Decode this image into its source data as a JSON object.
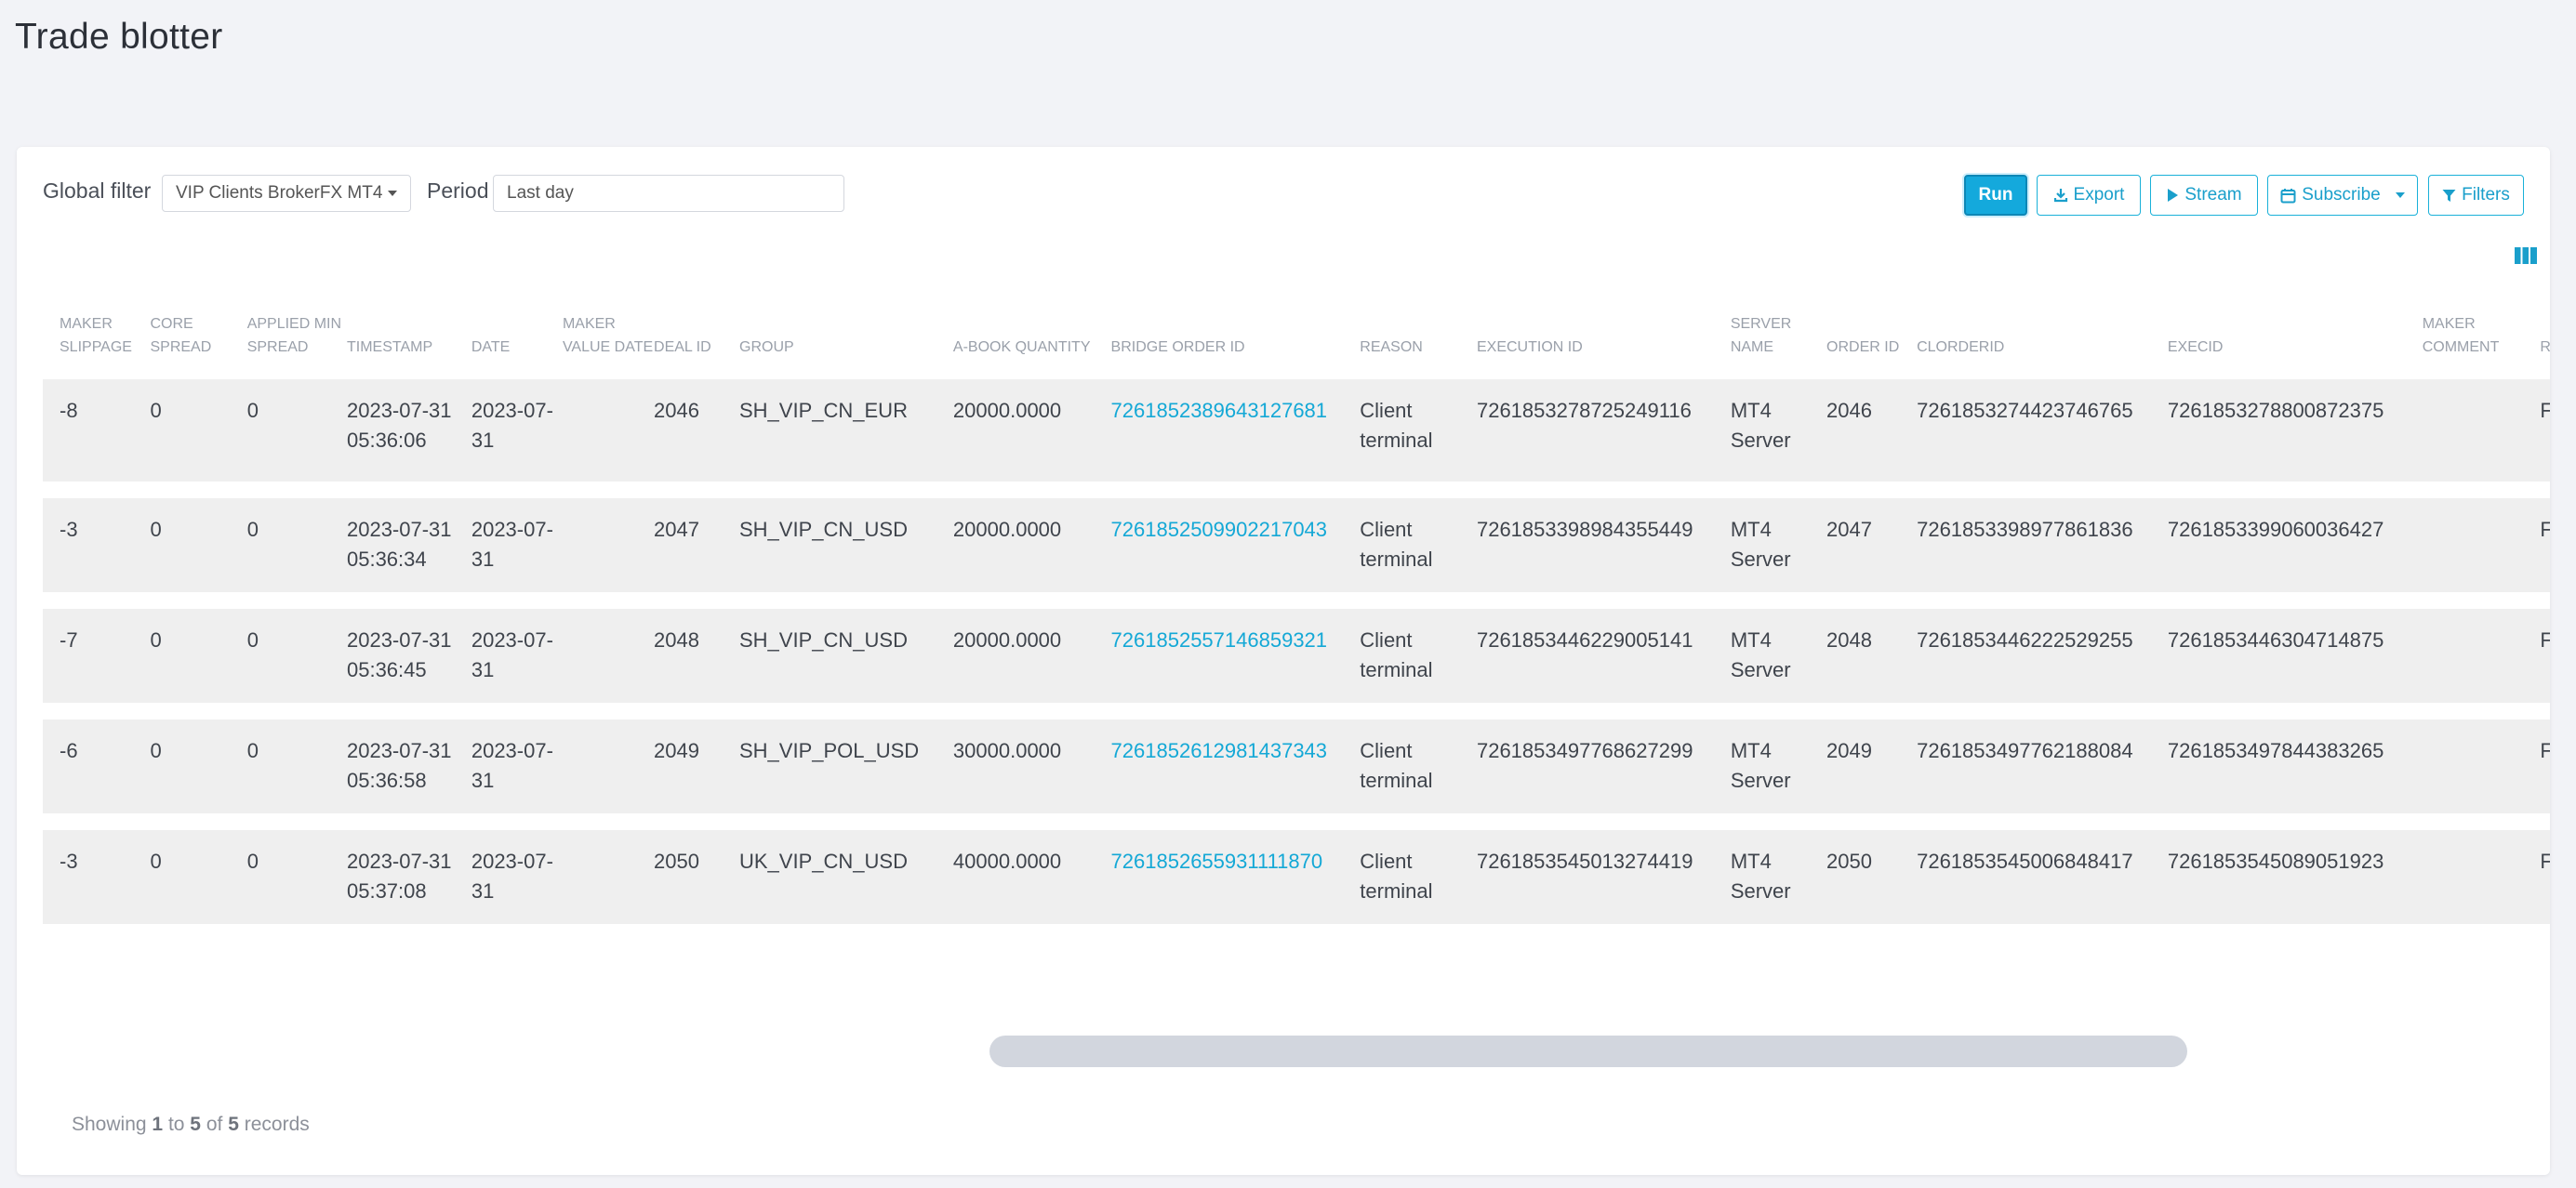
{
  "page": {
    "title": "Trade blotter"
  },
  "toolbar": {
    "global_filter_label": "Global filter",
    "global_filter_value": "VIP Clients BrokerFX MT4",
    "period_label": "Period",
    "period_value": "Last day",
    "run_label": "Run",
    "export_label": "Export",
    "stream_label": "Stream",
    "subscribe_label": "Subscribe",
    "filters_label": "Filters",
    "accent_color": "#14a9dc"
  },
  "table": {
    "headers": [
      "MAKER SLIPPAGE",
      "CORE SPREAD",
      "APPLIED MIN SPREAD",
      "TIMESTAMP",
      "DATE",
      "MAKER VALUE DATE",
      "DEAL ID",
      "GROUP",
      "A-BOOK QUANTITY",
      "BRIDGE ORDER ID",
      "REASON",
      "EXECUTION ID",
      "SERVER NAME",
      "ORDER ID",
      "CLORDERID",
      "EXECID",
      "MAKER COMMENT",
      "RES"
    ],
    "rows": [
      [
        "-8",
        "0",
        "0",
        "2023-07-31 05:36:06",
        "2023-07-31",
        "",
        "2046",
        "SH_VIP_CN_EUR",
        "20000.0000",
        "7261852389643127681",
        "Client terminal",
        "7261853278725249116",
        "MT4 Server",
        "2046",
        "7261853274423746765",
        "7261853278800872375",
        "",
        "Fil"
      ],
      [
        "-3",
        "0",
        "0",
        "2023-07-31 05:36:34",
        "2023-07-31",
        "",
        "2047",
        "SH_VIP_CN_USD",
        "20000.0000",
        "7261852509902217043",
        "Client terminal",
        "7261853398984355449",
        "MT4 Server",
        "2047",
        "7261853398977861836",
        "7261853399060036427",
        "",
        "Fil"
      ],
      [
        "-7",
        "0",
        "0",
        "2023-07-31 05:36:45",
        "2023-07-31",
        "",
        "2048",
        "SH_VIP_CN_USD",
        "20000.0000",
        "7261852557146859321",
        "Client terminal",
        "7261853446229005141",
        "MT4 Server",
        "2048",
        "7261853446222529255",
        "7261853446304714875",
        "",
        "Fil"
      ],
      [
        "-6",
        "0",
        "0",
        "2023-07-31 05:36:58",
        "2023-07-31",
        "",
        "2049",
        "SH_VIP_POL_USD",
        "30000.0000",
        "7261852612981437343",
        "Client terminal",
        "7261853497768627299",
        "MT4 Server",
        "2049",
        "7261853497762188084",
        "7261853497844383265",
        "",
        "Fil"
      ],
      [
        "-3",
        "0",
        "0",
        "2023-07-31 05:37:08",
        "2023-07-31",
        "",
        "2050",
        "UK_VIP_CN_USD",
        "40000.0000",
        "7261852655931111870",
        "Client terminal",
        "7261853545013274419",
        "MT4 Server",
        "2050",
        "7261853545006848417",
        "7261853545089051923",
        "",
        "Fil"
      ]
    ]
  },
  "footer": {
    "prefix": "Showing",
    "from": "1",
    "to_word": "to",
    "to": "5",
    "of_word": "of",
    "total": "5",
    "suffix": "records"
  }
}
